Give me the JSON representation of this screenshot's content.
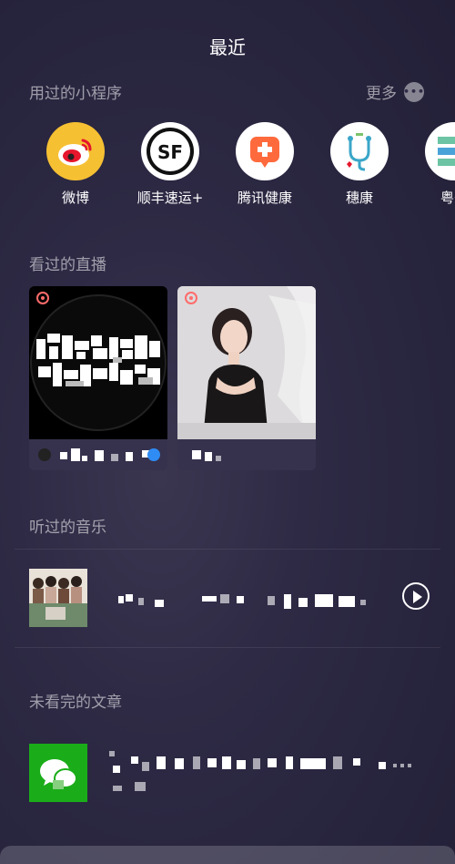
{
  "page": {
    "title": "最近"
  },
  "mini_programs": {
    "section_label": "用过的小程序",
    "more_label": "更多",
    "items": [
      {
        "label": "微博",
        "icon": "weibo-icon"
      },
      {
        "label": "顺丰速运+",
        "icon": "sf-express-icon"
      },
      {
        "label": "腾讯健康",
        "icon": "tencent-health-icon"
      },
      {
        "label": "穗康",
        "icon": "suikang-icon"
      },
      {
        "label": "粤省",
        "icon": "yueshengshi-icon"
      }
    ]
  },
  "live": {
    "section_label": "看过的直播"
  },
  "music": {
    "section_label": "听过的音乐"
  },
  "articles": {
    "section_label": "未看完的文章"
  },
  "colors": {
    "weibo_bg": "#f6c033",
    "sf_bg": "#ffffff",
    "health_bg": "#ff6a3d",
    "article_icon_bg": "#1aad19",
    "live_badge": "#ff6b6b"
  }
}
